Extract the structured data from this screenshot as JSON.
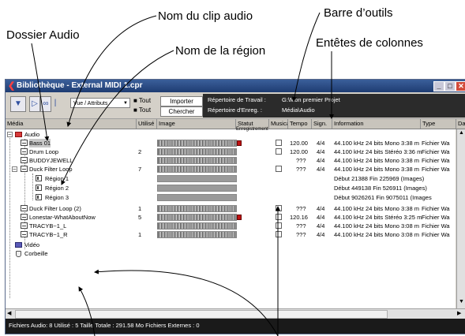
{
  "callouts": {
    "clip_name": "Nom du clip audio",
    "toolbar": "Barre d’outils",
    "audio_folder": "Dossier Audio",
    "column_headers": "Entêtes de colonnes",
    "region_name": "Nom de la région"
  },
  "window": {
    "title": "Bibliothèque - External MIDI 1.cpr"
  },
  "toolbar": {
    "view_select": "Vue / Attributs",
    "all1": "Tout",
    "all2": "Tout",
    "import_label": "Importer",
    "search_label": "Chercher",
    "workdir_label": "Répertoire de Travail :",
    "recdir_label": "Répertoire d'Enreg. :",
    "workdir_value": "G:\\Mon premier Projet",
    "recdir_value": "Média\\Audio"
  },
  "columns": [
    "Média",
    "Utilisé",
    "Image",
    "Statut",
    "Musical",
    "Tempo",
    "Sign.",
    "Information",
    "Type",
    "Da"
  ],
  "rows": [
    {
      "name": "Audio",
      "used": "",
      "status": "Enregistrement",
      "tempo": "",
      "sign": "",
      "info": "",
      "type": ""
    },
    {
      "name": "Bass 01",
      "used": "",
      "status": "",
      "tempo": "120.00",
      "sign": "4/4",
      "info": "44.100 kHz  24 bits  Mono  3:38 m",
      "type": "Fichier Wa"
    },
    {
      "name": "Drum Loop",
      "used": "2",
      "status": "",
      "tempo": "120.00",
      "sign": "4/4",
      "info": "44.100 kHz  24 bits  Stéréo  3:36 m",
      "type": "Fichier Wa"
    },
    {
      "name": "BUDDYJEWELL",
      "used": "",
      "status": "",
      "tempo": "???",
      "sign": "4/4",
      "info": "44.100 kHz  24 bits  Mono  3:38 m",
      "type": "Fichier Wa"
    },
    {
      "name": "Duck Filter Loop",
      "used": "7",
      "status": "",
      "tempo": "???",
      "sign": "4/4",
      "info": "44.100 kHz  24 bits  Mono  3:38 m",
      "type": "Fichier Wa"
    },
    {
      "name": "Région 1",
      "used": "",
      "status": "",
      "tempo": "",
      "sign": "",
      "info": "Début 21388  Fin 225969 (Images)",
      "type": ""
    },
    {
      "name": "Région 2",
      "used": "",
      "status": "",
      "tempo": "",
      "sign": "",
      "info": "Début 449138  Fin 526911 (Images)",
      "type": ""
    },
    {
      "name": "Région 3",
      "used": "",
      "status": "",
      "tempo": "",
      "sign": "",
      "info": "Début 9026261  Fin 9075011 (Images",
      "type": ""
    },
    {
      "name": "Duck Filter Loop (2)",
      "used": "1",
      "status": "",
      "tempo": "???",
      "sign": "4/4",
      "info": "44.100 kHz  24 bits  Mono  3:38 m",
      "type": "Fichier Wa"
    },
    {
      "name": "Lonestar-WhatAboutNow",
      "used": "5",
      "status": "",
      "tempo": "120.16",
      "sign": "4/4",
      "info": "44.100 kHz  24 bits  Stéréo  3:25 m",
      "type": "Fichier Wa"
    },
    {
      "name": "TRACYB~1_L",
      "used": "",
      "status": "",
      "tempo": "???",
      "sign": "4/4",
      "info": "44.100 kHz  24 bits  Mono  3:08 m",
      "type": "Fichier Wa"
    },
    {
      "name": "TRACYB~1_R",
      "used": "1",
      "status": "",
      "tempo": "???",
      "sign": "4/4",
      "info": "44.100 kHz  24 bits  Mono  3:08 m",
      "type": "Fichier Wa"
    },
    {
      "name": "Vidéo",
      "used": "",
      "status": "",
      "tempo": "",
      "sign": "",
      "info": "",
      "type": ""
    },
    {
      "name": "Corbeille",
      "used": "",
      "status": "",
      "tempo": "",
      "sign": "",
      "info": "",
      "type": ""
    }
  ],
  "status_text": "Fichiers Audio: 8   Utilisé : 5    Taille Totale : 291.58 Mo   Fichiers Externes : 0",
  "colors": {
    "titlebar": "#1e3c72",
    "audio_folder": "#d83a3a",
    "video_folder": "#5a5ab8",
    "rec_flag": "#c01010"
  }
}
